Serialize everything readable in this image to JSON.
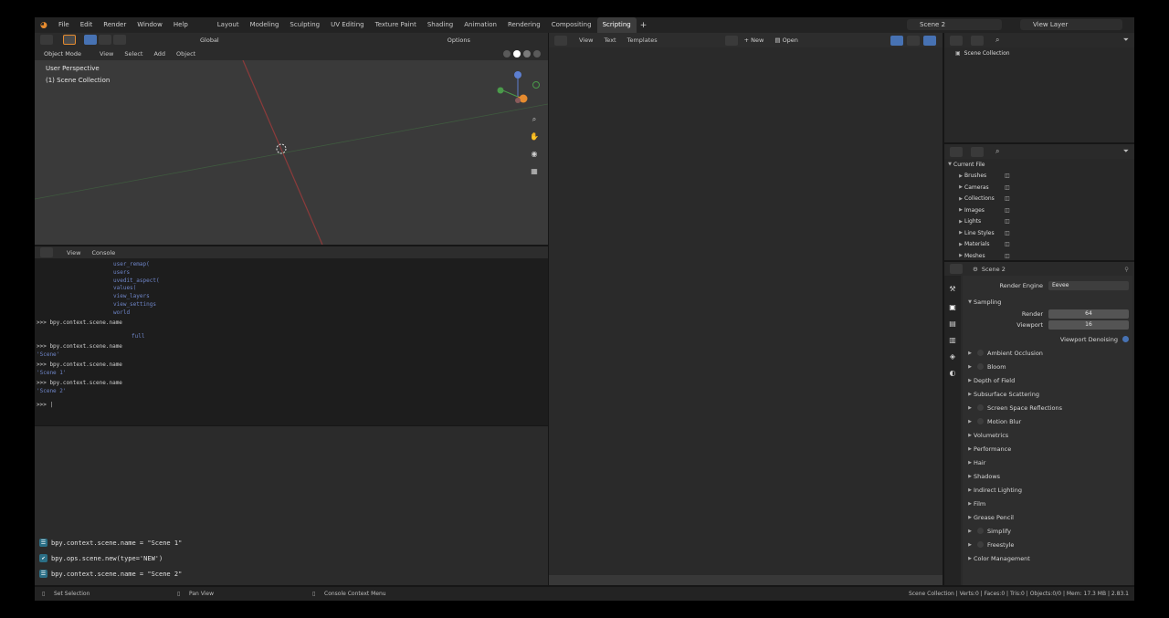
{
  "app": {
    "menus": [
      "File",
      "Edit",
      "Render",
      "Window",
      "Help"
    ],
    "workspaces": [
      "Layout",
      "Modeling",
      "Sculpting",
      "UV Editing",
      "Texture Paint",
      "Shading",
      "Animation",
      "Rendering",
      "Compositing",
      "Scripting"
    ],
    "active_workspace": "Scripting",
    "scene_name": "Scene 2",
    "view_layer": "View Layer"
  },
  "viewport": {
    "transform_orientation": "Global",
    "options_label": "Options",
    "mode": "Object Mode",
    "menu": [
      "View",
      "Select",
      "Add",
      "Object"
    ],
    "perspective": "User Perspective",
    "collection": "(1) Scene Collection"
  },
  "console": {
    "menu": [
      "View",
      "Console"
    ],
    "autocomplete": [
      "user_remap(",
      "users",
      "uvedit_aspect(",
      "values(",
      "view_layers",
      "view_settings",
      "world"
    ],
    "lines": [
      {
        "cmd": ">>> bpy.context.scene.name",
        "out": "full"
      },
      {
        "cmd": ">>> bpy.context.scene.name",
        "out": "'Scene'"
      },
      {
        "cmd": ">>> bpy.context.scene.name",
        "out": "'Scene 1'"
      },
      {
        "cmd": ">>> bpy.context.scene.name",
        "out": "'Scene 2'"
      }
    ],
    "prompt": ">>> |"
  },
  "info": {
    "rows": [
      {
        "text": "bpy.context.scene.name = \"Scene 1\"",
        "icon": "properties-icon"
      },
      {
        "text": "bpy.ops.scene.new(type='NEW')",
        "icon": "check-icon"
      },
      {
        "text": "bpy.context.scene.name = \"Scene 2\"",
        "icon": "properties-icon"
      }
    ]
  },
  "text_editor": {
    "menu": [
      "View",
      "Text",
      "Templates"
    ],
    "new_label": "New",
    "open_label": "Open"
  },
  "outliner": {
    "scene_collection": "Scene Collection",
    "current_file": "Current File",
    "items": [
      "Brushes",
      "Cameras",
      "Collections",
      "Images",
      "Lights",
      "Line Styles",
      "Materials",
      "Meshes"
    ]
  },
  "properties": {
    "scene_label": "Scene 2",
    "render_engine_label": "Render Engine",
    "render_engine_value": "Eevee",
    "sampling": "Sampling",
    "render_label": "Render",
    "render_value": "64",
    "viewport_label": "Viewport",
    "viewport_value": "16",
    "denoising_label": "Viewport Denoising",
    "panels": [
      {
        "label": "Ambient Occlusion",
        "toggle": true
      },
      {
        "label": "Bloom",
        "toggle": true
      },
      {
        "label": "Depth of Field",
        "toggle": false
      },
      {
        "label": "Subsurface Scattering",
        "toggle": false
      },
      {
        "label": "Screen Space Reflections",
        "toggle": true
      },
      {
        "label": "Motion Blur",
        "toggle": true
      },
      {
        "label": "Volumetrics",
        "toggle": false
      },
      {
        "label": "Performance",
        "toggle": false
      },
      {
        "label": "Hair",
        "toggle": false
      },
      {
        "label": "Shadows",
        "toggle": false
      },
      {
        "label": "Indirect Lighting",
        "toggle": false
      },
      {
        "label": "Film",
        "toggle": false
      },
      {
        "label": "Grease Pencil",
        "toggle": false
      },
      {
        "label": "Simplify",
        "toggle": true
      },
      {
        "label": "Freestyle",
        "toggle": true
      },
      {
        "label": "Color Management",
        "toggle": false
      }
    ]
  },
  "status": {
    "left": "Set Selection",
    "middle": "Pan View",
    "right": "Console Context Menu",
    "stats": "Scene Collection | Verts:0 | Faces:0 | Tris:0 | Objects:0/0 | Mem: 17.3 MB | 2.83.1"
  },
  "colors": {
    "accent": "#e58b2f",
    "active_blue": "#4772b3",
    "console_output": "#6e85c8"
  }
}
